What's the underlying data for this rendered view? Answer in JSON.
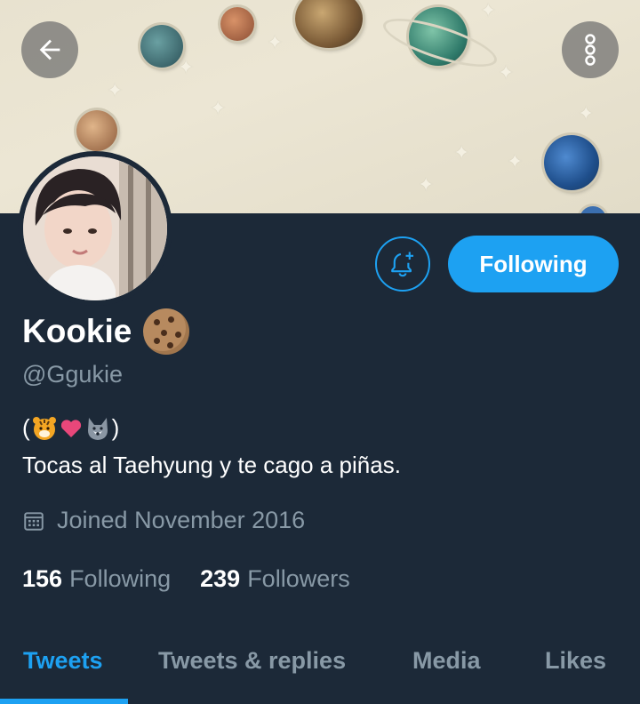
{
  "header": {
    "back_icon": "arrow-left-icon",
    "menu_icon": "vertical-dots-icon"
  },
  "profile": {
    "name": "Kookie",
    "name_emoji": "cookie-emoji",
    "handle": "@Ggukie",
    "bio_prefix": "(",
    "bio_suffix": ")",
    "bio_emojis": [
      "tiger-face-emoji",
      "heart-emoji",
      "wolf-face-emoji"
    ],
    "bio_text": "Tocas al Taehyung y te cago a piñas.",
    "joined": "Joined November 2016",
    "following_count": "156",
    "following_label": "Following",
    "followers_count": "239",
    "followers_label": "Followers"
  },
  "actions": {
    "notify_icon": "bell-plus-icon",
    "following_button": "Following"
  },
  "tabs": [
    {
      "label": "Tweets",
      "active": true
    },
    {
      "label": "Tweets & replies",
      "active": false
    },
    {
      "label": "Media",
      "active": false
    },
    {
      "label": "Likes",
      "active": false
    }
  ],
  "colors": {
    "background": "#1c2938",
    "accent": "#1da1f2",
    "muted_text": "#8899a6",
    "primary_text": "#ffffff"
  }
}
